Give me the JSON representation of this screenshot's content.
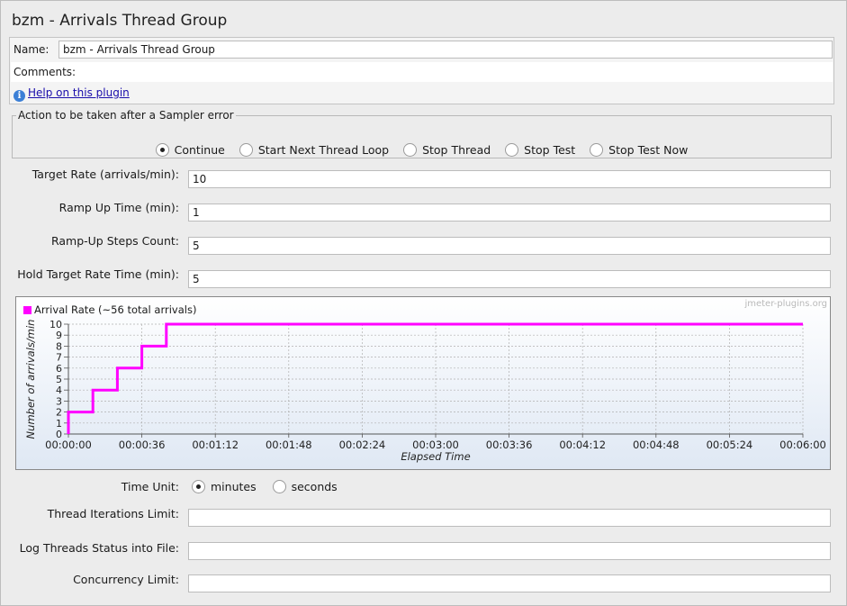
{
  "title": "bzm - Arrivals Thread Group",
  "name": {
    "label": "Name:",
    "value": "bzm - Arrivals Thread Group"
  },
  "comments": {
    "label": "Comments:",
    "value": ""
  },
  "help_link": "Help on this plugin",
  "sampler_error": {
    "legend": "Action to be taken after a Sampler error",
    "options": [
      "Continue",
      "Start Next Thread Loop",
      "Stop Thread",
      "Stop Test",
      "Stop Test Now"
    ],
    "selected": "Continue"
  },
  "fields": {
    "target_rate": {
      "label": "Target Rate (arrivals/min):",
      "value": "10"
    },
    "ramp_up_time": {
      "label": "Ramp Up Time (min):",
      "value": "1"
    },
    "ramp_up_steps": {
      "label": "Ramp-Up Steps Count:",
      "value": "5"
    },
    "hold_time": {
      "label": "Hold Target Rate Time (min):",
      "value": "5"
    }
  },
  "chart_data": {
    "type": "line",
    "watermark": "jmeter-plugins.org",
    "legend": "Arrival Rate (~56 total arrivals)",
    "series": [
      {
        "name": "Arrival Rate (~56 total arrivals)",
        "color": "#ff00ff",
        "x": [
          "00:00:00",
          "00:00:00",
          "00:00:12",
          "00:00:12",
          "00:00:24",
          "00:00:24",
          "00:00:36",
          "00:00:36",
          "00:00:48",
          "00:00:48",
          "00:06:00"
        ],
        "y": [
          0,
          2,
          2,
          4,
          4,
          6,
          6,
          8,
          8,
          10,
          10
        ]
      }
    ],
    "xlabel": "Elapsed Time",
    "ylabel": "Number of arrivals/min",
    "x_ticks": [
      "00:00:00",
      "00:00:36",
      "00:01:12",
      "00:01:48",
      "00:02:24",
      "00:03:00",
      "00:03:36",
      "00:04:12",
      "00:04:48",
      "00:05:24",
      "00:06:00"
    ],
    "y_ticks": [
      "0",
      "1",
      "2",
      "3",
      "4",
      "5",
      "6",
      "7",
      "8",
      "9",
      "10"
    ],
    "xlim": [
      "00:00:00",
      "00:06:00"
    ],
    "ylim": [
      0,
      10
    ],
    "grid": true
  },
  "time_unit": {
    "label": "Time Unit:",
    "options": [
      "minutes",
      "seconds"
    ],
    "selected": "minutes"
  },
  "bottom_fields": {
    "iterations": {
      "label": "Thread Iterations Limit:",
      "value": ""
    },
    "log_file": {
      "label": "Log Threads Status into File:",
      "value": ""
    },
    "concurrency": {
      "label": "Concurrency Limit:",
      "value": ""
    }
  }
}
